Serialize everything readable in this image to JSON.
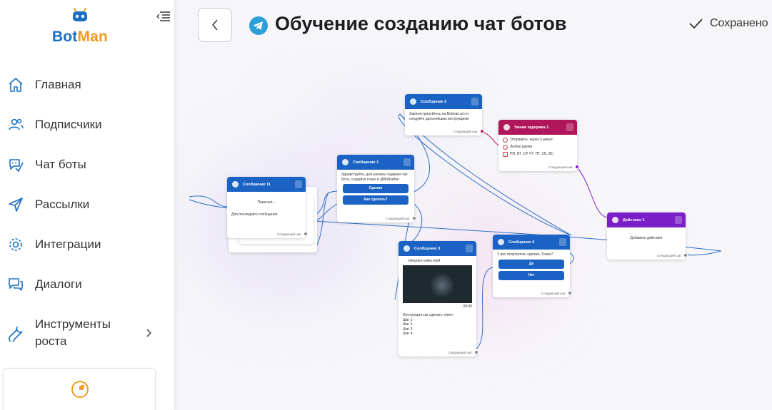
{
  "brand": {
    "part1": "Bot",
    "part2": "Man",
    "color_primary": "#1b6fc2",
    "color_accent": "#f29a1f"
  },
  "sidebar": {
    "items": [
      {
        "label": "Главная",
        "icon": "home-icon"
      },
      {
        "label": "Подписчики",
        "icon": "users-icon"
      },
      {
        "label": "Чат боты",
        "icon": "chatbot-icon"
      },
      {
        "label": "Рассылки",
        "icon": "send-icon"
      },
      {
        "label": "Интеграции",
        "icon": "gear-icon"
      },
      {
        "label": "Диалоги",
        "icon": "dialogs-icon"
      },
      {
        "label": "Инструменты\nроста",
        "icon": "wrench-icon"
      }
    ]
  },
  "header": {
    "title": "Обучение созданию чат ботов",
    "saved_label": "Сохранено"
  },
  "nodes": {
    "msg11": {
      "title": "Сообщение 11",
      "line1": "Пересыл...",
      "text": "Для последнего сообщения",
      "footer": "Следующий шаг"
    },
    "msg1": {
      "title": "Сообщение 1",
      "text": "Здравствуйте, для начала создания чат бота, создайте токен в @BotFather",
      "btn1": "Сделал",
      "btn2": "Как сделать?",
      "footer": "Следующий шаг"
    },
    "msg2": {
      "title": "Сообщение 2",
      "text": "Зарегистрируйтесь на Botman.pro и следуйте дальнейшим инструкциям",
      "footer": "Следующий шаг"
    },
    "smart": {
      "title": "Умная задержка 1",
      "row1": "Отправить: через 5 минут",
      "row2": "Любое время",
      "row3": "ПН, ВТ, СР, ЧТ, ПТ, СБ, ВС",
      "footer": "Следующий шаг"
    },
    "action": {
      "title": "Действие 1",
      "text": "Добавить действие",
      "footer": "Следующий шаг"
    },
    "msg3": {
      "title": "Сообщение 3",
      "file": "telegram-video.mp4",
      "time": "00:00",
      "text": "Инструкция как сделать токен:\nШаг 1 -\nШаг 2 -\nШаг 3 -\nШаг 4 -",
      "footer": "Следующий шаг"
    },
    "msg4": {
      "title": "Сообщение 4",
      "text": "У вас получилось сделать Токен?",
      "btn1": "Да",
      "btn2": "Нет",
      "footer": "Следующий шаг"
    }
  },
  "colors": {
    "node_blue": "#1a63c4",
    "smart_delay": "#b0175a",
    "action": "#7a1fc8"
  }
}
